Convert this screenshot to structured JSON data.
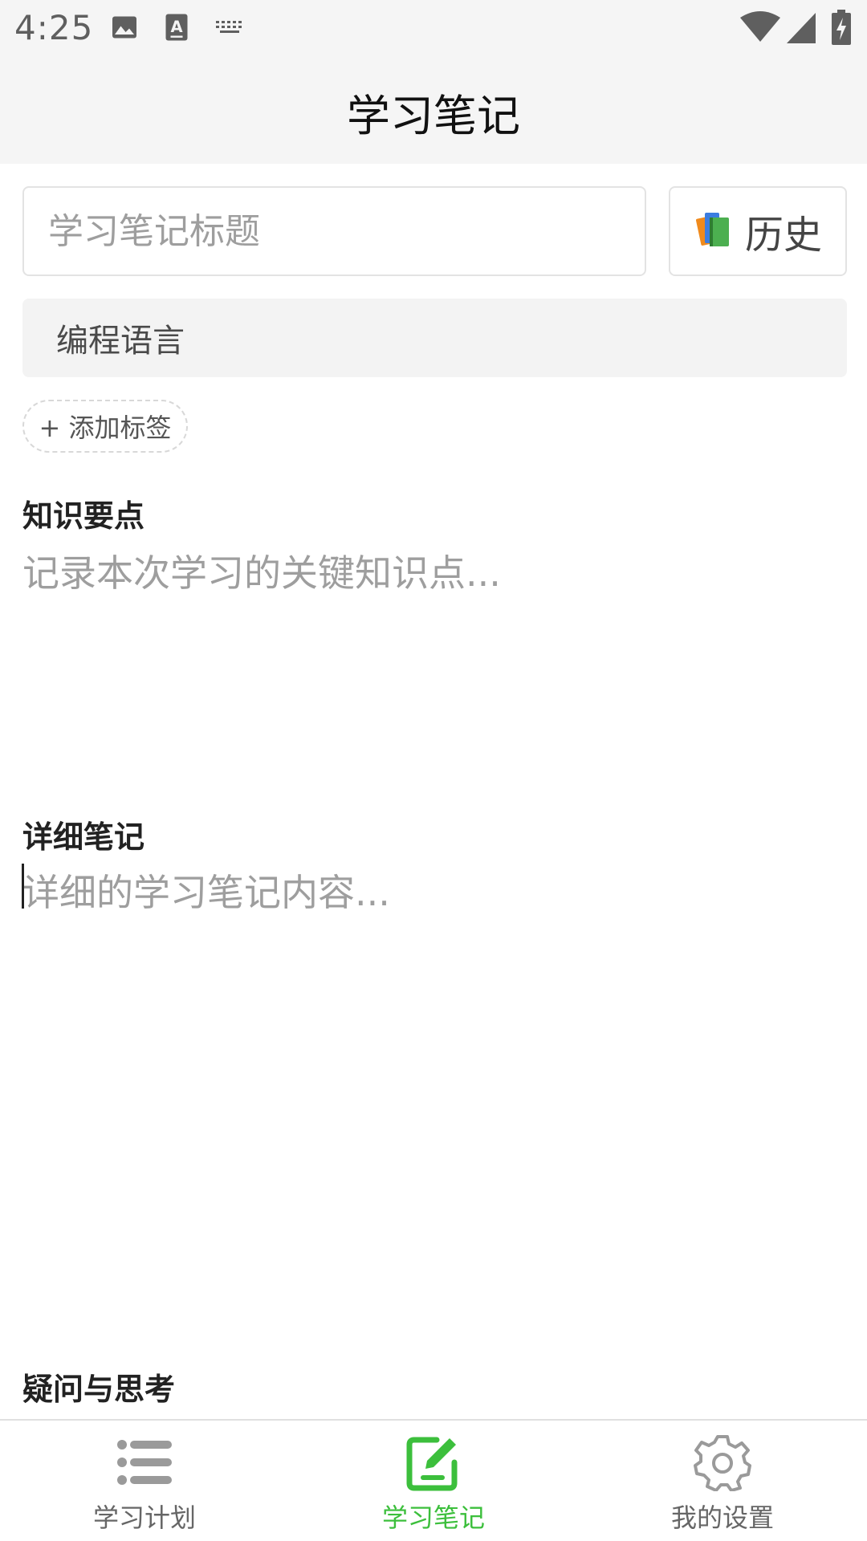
{
  "status_bar": {
    "time": "4:25",
    "left_icons": [
      "image-icon",
      "text-a-icon",
      "keyboard-icon"
    ],
    "right_icons": [
      "wifi-icon",
      "signal-icon",
      "battery-charging-icon"
    ]
  },
  "header": {
    "title": "学习笔记"
  },
  "form": {
    "title_placeholder": "学习笔记标题",
    "history_label": "历史",
    "history_icon": "books-icon",
    "category_value": "编程语言",
    "add_tag_label": "+ 添加标签",
    "sections": {
      "key_points": {
        "label": "知识要点",
        "placeholder": "记录本次学习的关键知识点..."
      },
      "details": {
        "label": "详细笔记",
        "placeholder": "详细的学习笔记内容..."
      },
      "questions": {
        "label": "疑问与思考"
      }
    }
  },
  "bottom_nav": {
    "items": [
      {
        "label": "学习计划",
        "icon": "list-icon",
        "active": false
      },
      {
        "label": "学习笔记",
        "icon": "edit-note-icon",
        "active": true
      },
      {
        "label": "我的设置",
        "icon": "gear-icon",
        "active": false
      }
    ]
  },
  "colors": {
    "accent": "#3cbf3c",
    "header_bg": "#f5f5f5",
    "placeholder": "#9e9e9e",
    "nav_inactive": "#999999"
  }
}
